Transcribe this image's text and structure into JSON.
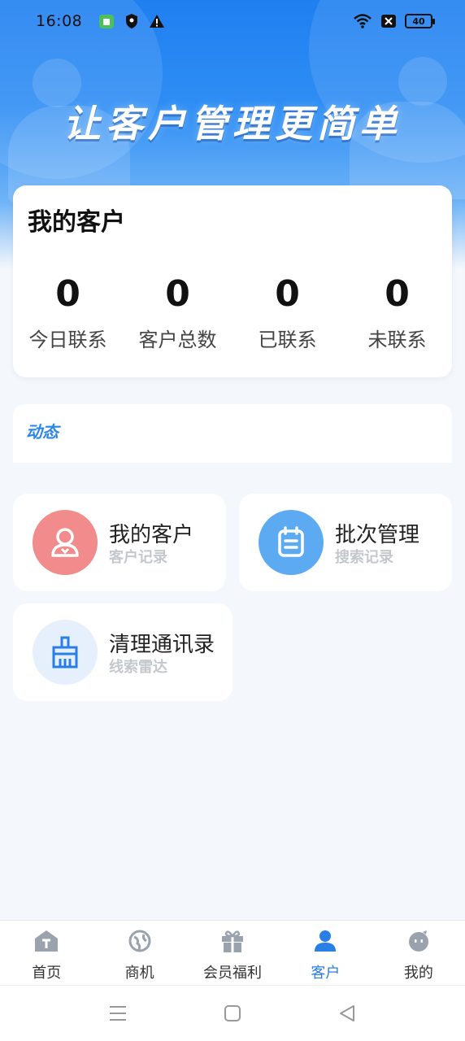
{
  "status_bar": {
    "time": "16:08",
    "battery": "40",
    "left_icons": [
      "app-notification-icon",
      "shield-icon",
      "warning-icon"
    ],
    "right_icons": [
      "wifi-icon",
      "sim-off-icon",
      "battery-icon"
    ]
  },
  "banner": {
    "title": "让客户管理更简单"
  },
  "stats": {
    "title": "我的客户",
    "items": [
      {
        "value": "0",
        "label": "今日联系"
      },
      {
        "value": "0",
        "label": "客户总数"
      },
      {
        "value": "0",
        "label": "已联系"
      },
      {
        "value": "0",
        "label": "未联系"
      }
    ]
  },
  "dynamic": {
    "label": "动态"
  },
  "features": [
    {
      "title": "我的客户",
      "subtitle": "客户记录",
      "icon": "user-icon",
      "icon_color": "#f28b8b"
    },
    {
      "title": "批次管理",
      "subtitle": "搜索记录",
      "icon": "notepad-icon",
      "icon_color": "#5caaf2"
    },
    {
      "title": "清理通讯录",
      "subtitle": "线索雷达",
      "icon": "broom-icon",
      "icon_color": "#e6f0fc"
    }
  ],
  "tabbar": {
    "active": "客户",
    "items": [
      {
        "label": "首页",
        "icon": "home-icon"
      },
      {
        "label": "商机",
        "icon": "globe-icon"
      },
      {
        "label": "会员福利",
        "icon": "gift-icon"
      },
      {
        "label": "客户",
        "icon": "person-icon"
      },
      {
        "label": "我的",
        "icon": "face-icon"
      }
    ]
  },
  "colors": {
    "primary": "#2a7fe6",
    "page_bg": "#f4f7fc",
    "subtitle": "#c4c8ce"
  }
}
